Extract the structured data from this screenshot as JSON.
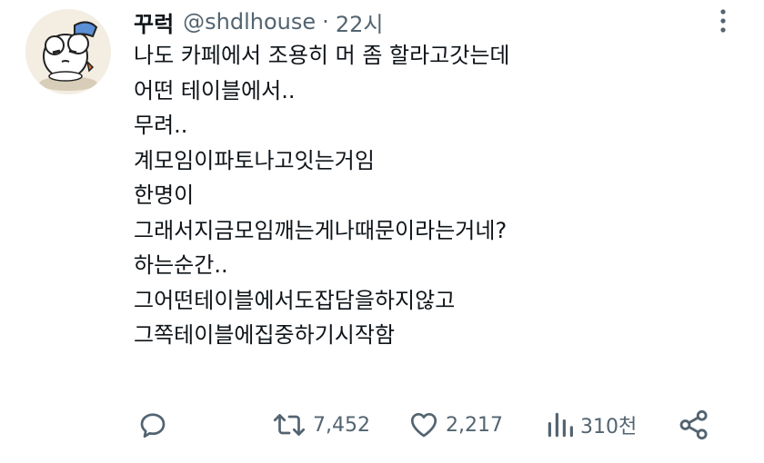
{
  "tweet": {
    "display_name": "꾸럭",
    "handle": "@shdlhouse",
    "separator": "·",
    "time": "22시",
    "lines": [
      "나도 카페에서 조용히 머 좀 할라고갓는데",
      "어떤 테이블에서..",
      "무려..",
      "계모임이파토나고잇는거임",
      "한명이",
      "그래서지금모임깨는게나때문이라는거네?",
      "하는순간..",
      "그어떤테이블에서도잡담을하지않고",
      "그쪽테이블에집중하기시작함"
    ]
  },
  "actions": {
    "reply_icon": "speech-bubble",
    "retweet_icon": "retweet-arrows",
    "retweet_count": "7,452",
    "like_icon": "heart",
    "like_count": "2,217",
    "views_icon": "bar-chart",
    "views_count": "310천",
    "share_icon": "share-nodes"
  },
  "colors": {
    "text": "#0f1419",
    "muted": "#536471",
    "background": "#ffffff"
  }
}
